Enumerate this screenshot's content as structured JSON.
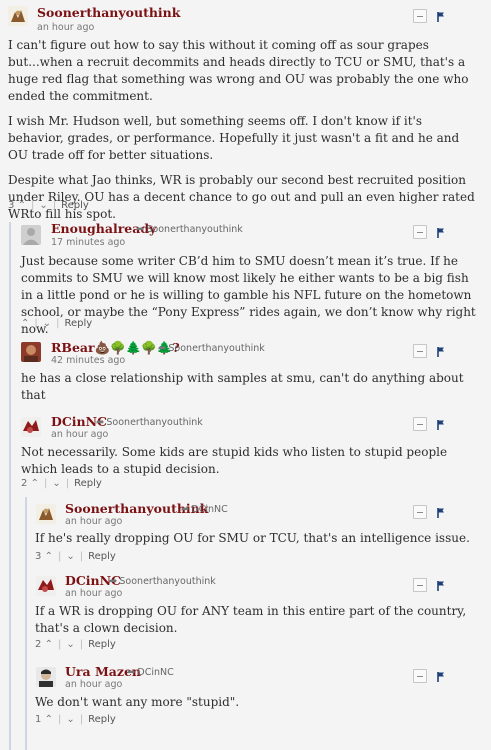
{
  "comments": [
    {
      "author": "Soonerthanyouthink",
      "time": "an hour ago",
      "paragraphs": [
        "I can't figure out how to say this without it coming off as sour grapes but...when a recruit decommits and heads directly to TCU or SMU, that's a huge red flag that something was wrong and OU was probably the one who ended the commitment.",
        "I wish Mr. Hudson well, but something seems off. I don't know if it's behavior, grades, or performance. Hopefully it just wasn't a fit and he and OU trade off for better situations.",
        "Despite what Jao thinks, WR is probably our second best recruited position under Riley. OU has a decent chance to go out and pull an even higher rated WRto fill his spot."
      ],
      "votes": "3",
      "reply": "Reply"
    },
    {
      "author": "Enoughalready",
      "reply_to": "Soonerthanyouthink",
      "time": "17 minutes ago",
      "paragraphs": [
        "Just because some writer CB’d him to SMU doesn’t mean it’s true. If he commits to SMU we will know most likely he either wants to be a big fish in a little pond or he is willing to gamble his NFL future on the hometown school, or maybe the “Pony Express” rides again, we don’t know why right now."
      ],
      "votes": "",
      "reply": "Reply"
    },
    {
      "author": "RBear💩🌳🌲🌳🌲?",
      "reply_to": "Soonerthanyouthink",
      "time": "42 minutes ago",
      "paragraphs": [
        "he has a close relationship with samples at smu, can't do anything about that"
      ],
      "votes": "",
      "reply": ""
    },
    {
      "author": "DCinNC",
      "reply_to": "Soonerthanyouthink",
      "time": "an hour ago",
      "paragraphs": [
        "Not necessarily. Some kids are stupid kids who listen to stupid people which leads to a stupid decision."
      ],
      "votes": "2",
      "reply": "Reply"
    },
    {
      "author": "Soonerthanyouthink",
      "reply_to": "DCinNC",
      "time": "an hour ago",
      "paragraphs": [
        "If he's really dropping OU for SMU or TCU, that's an intelligence issue."
      ],
      "votes": "3",
      "reply": "Reply"
    },
    {
      "author": "DCinNC",
      "reply_to": "Soonerthanyouthink",
      "time": "an hour ago",
      "paragraphs": [
        "If a WR is dropping OU for ANY team in this entire part of the country, that's a clown decision."
      ],
      "votes": "2",
      "reply": "Reply"
    },
    {
      "author": "Ura Mazen",
      "reply_to": "DCinNC",
      "time": "an hour ago",
      "paragraphs": [
        "We don't want any more \"stupid\"."
      ],
      "votes": "1",
      "reply": "Reply"
    }
  ],
  "colors": {
    "author": "#7b1113",
    "flag": "#1f3f7a",
    "thread_line": "#cfd6e3",
    "background": "#f4f4f4"
  },
  "icons": {
    "collapse": "minus-box-icon",
    "flag": "flag-icon",
    "upvote": "chevron-up-icon",
    "downvote": "chevron-down-icon",
    "reply_arrow": "share-arrow-icon"
  }
}
